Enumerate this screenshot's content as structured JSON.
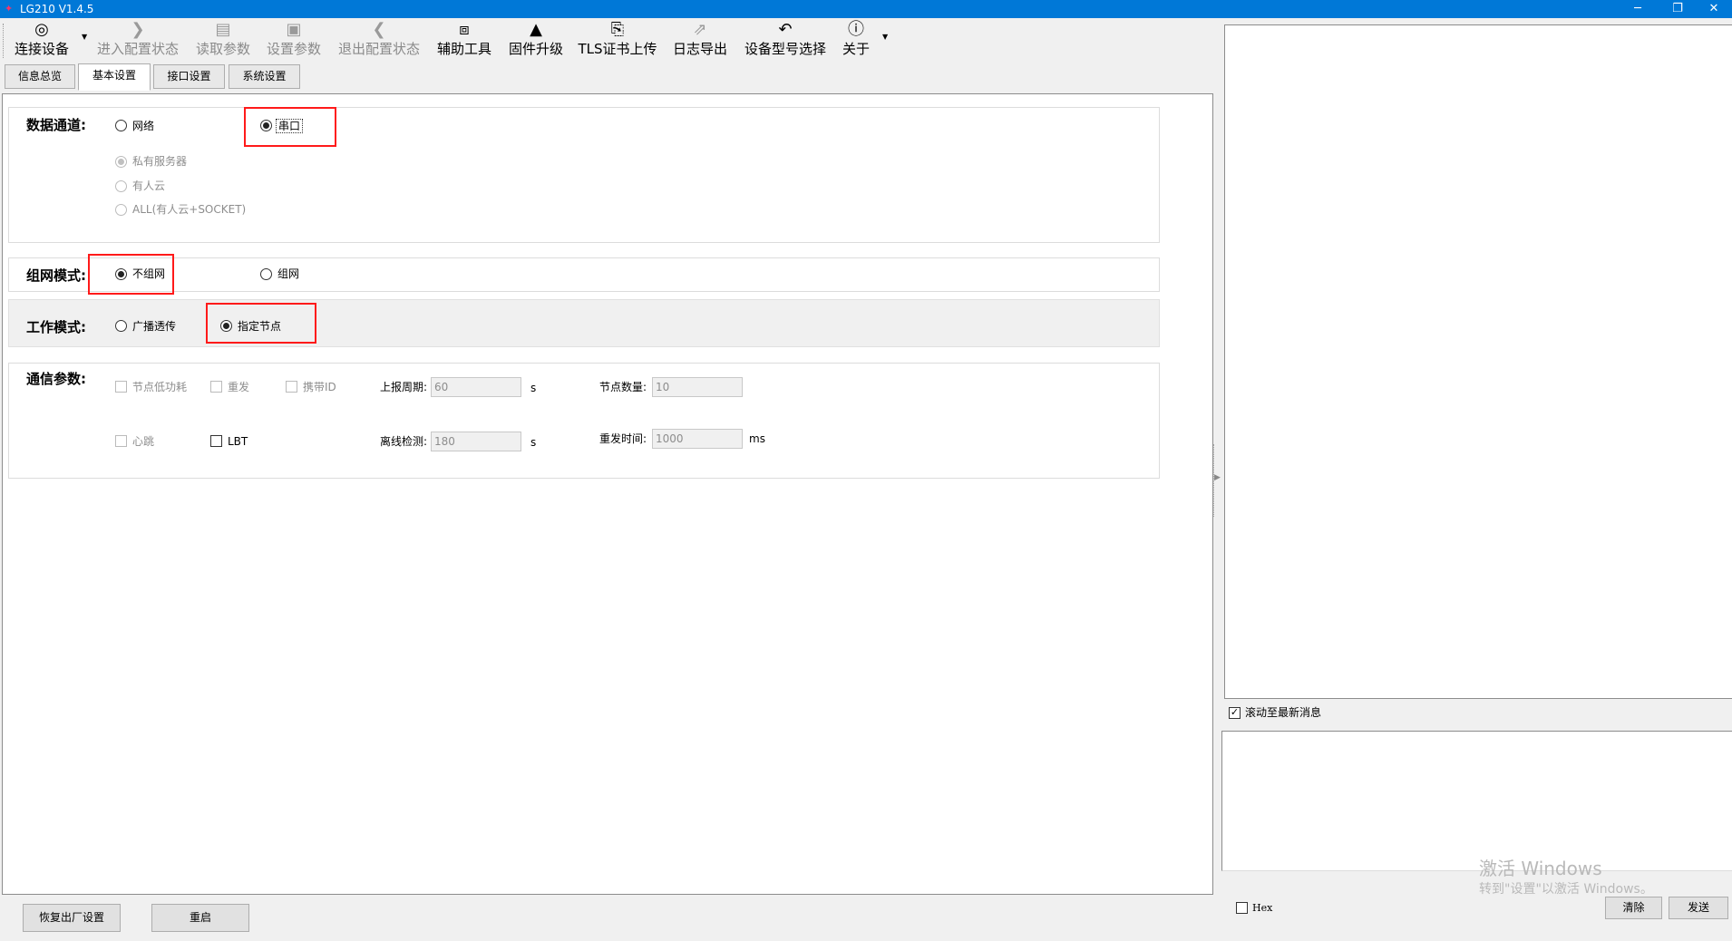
{
  "window": {
    "title": "LG210 V1.4.5",
    "minimize": "─",
    "restore": "❐",
    "close": "✕"
  },
  "toolbar": [
    {
      "label": "连接设备",
      "icon": "location-check-icon",
      "glyph": "◎",
      "disabled": false
    },
    {
      "label": "进入配置状态",
      "icon": "chevron-right-icon",
      "glyph": "❯",
      "disabled": true
    },
    {
      "label": "读取参数",
      "icon": "read-document-icon",
      "glyph": "▤",
      "disabled": true
    },
    {
      "label": "设置参数",
      "icon": "save-icon",
      "glyph": "▣",
      "disabled": true
    },
    {
      "label": "退出配置状态",
      "icon": "chevron-left-icon",
      "glyph": "❮",
      "disabled": true
    },
    {
      "label": "辅助工具",
      "icon": "toolbox-icon",
      "glyph": "⧈",
      "disabled": false
    },
    {
      "label": "固件升级",
      "icon": "rocket-icon",
      "glyph": "▲",
      "disabled": false
    },
    {
      "label": "TLS证书上传",
      "icon": "certificate-icon",
      "glyph": "⎘",
      "disabled": false
    },
    {
      "label": "日志导出",
      "icon": "export-icon",
      "glyph": "⇗",
      "disabled": false
    },
    {
      "label": "设备型号选择",
      "icon": "undo-arrow-icon",
      "glyph": "↶",
      "disabled": false
    },
    {
      "label": "关于",
      "icon": "info-icon",
      "glyph": "ⓘ",
      "disabled": false
    }
  ],
  "tabs": [
    "信息总览",
    "基本设置",
    "接口设置",
    "系统设置"
  ],
  "data_channel": {
    "label": "数据通道:",
    "options": [
      "网络",
      "串口"
    ],
    "selected": "串口",
    "sub_options": [
      "私有服务器",
      "有人云",
      "ALL(有人云+SOCKET)"
    ],
    "sub_selected": "私有服务器"
  },
  "network_mode": {
    "label": "组网模式:",
    "options": [
      "不组网",
      "组网"
    ],
    "selected": "不组网"
  },
  "work_mode": {
    "label": "工作模式:",
    "options": [
      "广播透传",
      "指定节点"
    ],
    "selected": "指定节点"
  },
  "comm": {
    "label": "通信参数:",
    "checkboxes": [
      {
        "label": "节点低功耗",
        "checked": false
      },
      {
        "label": "重发",
        "checked": false
      },
      {
        "label": "携带ID",
        "checked": false
      },
      {
        "label": "心跳",
        "checked": false
      },
      {
        "label": "LBT",
        "checked": false
      }
    ],
    "report_period": {
      "label": "上报周期:",
      "value": "60",
      "unit": "s"
    },
    "node_count": {
      "label": "节点数量:",
      "value": "10"
    },
    "offline_detect": {
      "label": "离线检测:",
      "value": "180",
      "unit": "s"
    },
    "resend_time": {
      "label": "重发时间:",
      "value": "1000",
      "unit": "ms"
    }
  },
  "bottom": {
    "factory_reset": "恢复出厂设置",
    "restart": "重启"
  },
  "right": {
    "scroll_latest": "滚动至最新消息",
    "scroll_checked": true,
    "hex": "Hex",
    "clear": "清除",
    "send": "发送"
  },
  "watermark": {
    "line1": "激活 Windows",
    "line2": "转到\"设置\"以激活 Windows。"
  },
  "colors": {
    "titlebar": "#0078d7",
    "highlight": "#ff1a1a"
  }
}
